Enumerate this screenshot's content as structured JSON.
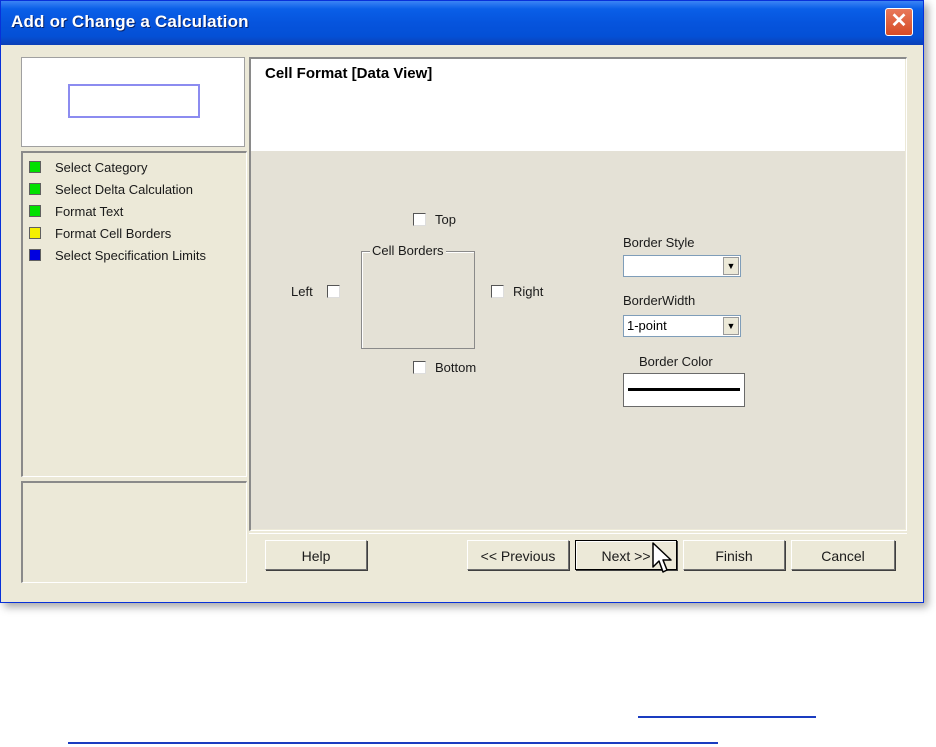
{
  "window": {
    "title": "Add or Change a Calculation",
    "close_glyph": "✕"
  },
  "steps": [
    {
      "label": "Select Category",
      "color": "#00e000"
    },
    {
      "label": "Select Delta Calculation",
      "color": "#00e000"
    },
    {
      "label": "Format Text",
      "color": "#00e000"
    },
    {
      "label": "Format Cell Borders",
      "color": "#f5f000"
    },
    {
      "label": "Select Specification Limits",
      "color": "#0000e0"
    }
  ],
  "panel": {
    "title": "Cell Format [Data View]"
  },
  "borders": {
    "group_label": "Cell Borders",
    "top_label": "Top",
    "left_label": "Left",
    "right_label": "Right",
    "bottom_label": "Bottom",
    "top_checked": false,
    "left_checked": false,
    "right_checked": false,
    "bottom_checked": false
  },
  "border_style": {
    "label": "Border Style",
    "value": ""
  },
  "border_width": {
    "label": "BorderWidth",
    "value": "1-point"
  },
  "border_color": {
    "label": "Border Color",
    "value": "#000000"
  },
  "buttons": {
    "help": "Help",
    "previous": "<< Previous",
    "next": "Next >>",
    "finish": "Finish",
    "cancel": "Cancel"
  },
  "icons": {
    "dropdown": "chevron-down-icon",
    "cursor": "mouse-pointer-icon"
  }
}
